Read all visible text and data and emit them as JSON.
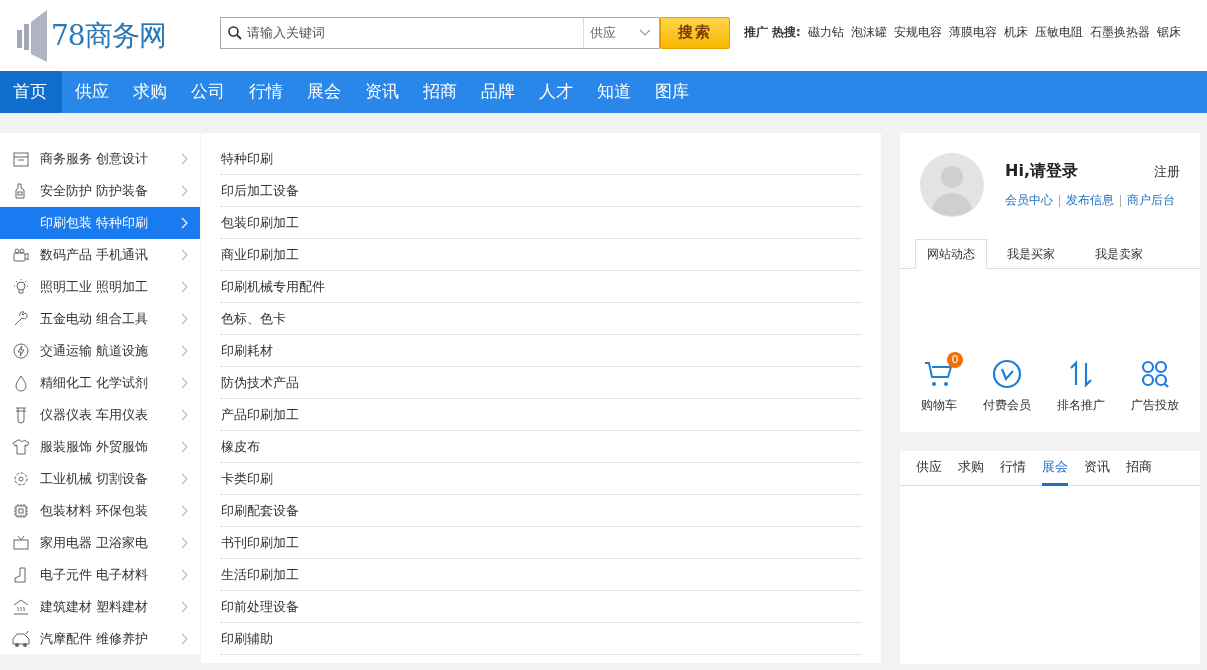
{
  "logo": {
    "text": "78商务网"
  },
  "search": {
    "placeholder": "请输入关键词",
    "category": "供应",
    "button": "搜索"
  },
  "hot": {
    "label": "推广 热搜:",
    "keywords": [
      "磁力钻",
      "泡沫罐",
      "安规电容",
      "薄膜电容",
      "机床",
      "压敏电阻",
      "石墨换热器",
      "锯床"
    ]
  },
  "nav": [
    {
      "label": "首页",
      "selected": true
    },
    {
      "label": "供应",
      "selected": false
    },
    {
      "label": "求购",
      "selected": false
    },
    {
      "label": "公司",
      "selected": false
    },
    {
      "label": "行情",
      "selected": false
    },
    {
      "label": "展会",
      "selected": false
    },
    {
      "label": "资讯",
      "selected": false
    },
    {
      "label": "招商",
      "selected": false
    },
    {
      "label": "品牌",
      "selected": false
    },
    {
      "label": "人才",
      "selected": false
    },
    {
      "label": "知道",
      "selected": false
    },
    {
      "label": "图库",
      "selected": false
    }
  ],
  "categories": [
    {
      "label": "商务服务 创意设计",
      "selected": false
    },
    {
      "label": "安全防护 防护装备",
      "selected": false
    },
    {
      "label": "印刷包装 特种印刷",
      "selected": true
    },
    {
      "label": "数码产品 手机通讯",
      "selected": false
    },
    {
      "label": "照明工业 照明加工",
      "selected": false
    },
    {
      "label": "五金电动 组合工具",
      "selected": false
    },
    {
      "label": "交通运输 航道设施",
      "selected": false
    },
    {
      "label": "精细化工 化学试剂",
      "selected": false
    },
    {
      "label": "仪器仪表 车用仪表",
      "selected": false
    },
    {
      "label": "服装服饰 外贸服饰",
      "selected": false
    },
    {
      "label": "工业机械 切割设备",
      "selected": false
    },
    {
      "label": "包装材料 环保包装",
      "selected": false
    },
    {
      "label": "家用电器 卫浴家电",
      "selected": false
    },
    {
      "label": "电子元件 电子材料",
      "selected": false
    },
    {
      "label": "建筑建材 塑料建材",
      "selected": false
    },
    {
      "label": "汽摩配件 维修养护",
      "selected": false
    }
  ],
  "subcategories": [
    "特种印刷",
    "印后加工设备",
    "包装印刷加工",
    "商业印刷加工",
    "印刷机械专用配件",
    "色标、色卡",
    "印刷耗材",
    "防伪技术产品",
    "产品印刷加工",
    "橡皮布",
    "卡类印刷",
    "印刷配套设备",
    "书刊印刷加工",
    "生活印刷加工",
    "印前处理设备",
    "印刷辅助"
  ],
  "user": {
    "greeting": "Hi,请登录",
    "register": "注册",
    "links": [
      "会员中心",
      "发布信息",
      "商户后台"
    ]
  },
  "user_tabs": [
    {
      "label": "网站动态",
      "selected": true
    },
    {
      "label": "我是买家",
      "selected": false
    },
    {
      "label": "我是卖家",
      "selected": false
    }
  ],
  "quick": [
    {
      "label": "购物车",
      "badge": "0"
    },
    {
      "label": "付费会员"
    },
    {
      "label": "排名推广"
    },
    {
      "label": "广告投放"
    }
  ],
  "info_tabs": [
    {
      "label": "供应",
      "selected": false
    },
    {
      "label": "求购",
      "selected": false
    },
    {
      "label": "行情",
      "selected": false
    },
    {
      "label": "展会",
      "selected": true
    },
    {
      "label": "资讯",
      "selected": false
    },
    {
      "label": "招商",
      "selected": false
    }
  ]
}
